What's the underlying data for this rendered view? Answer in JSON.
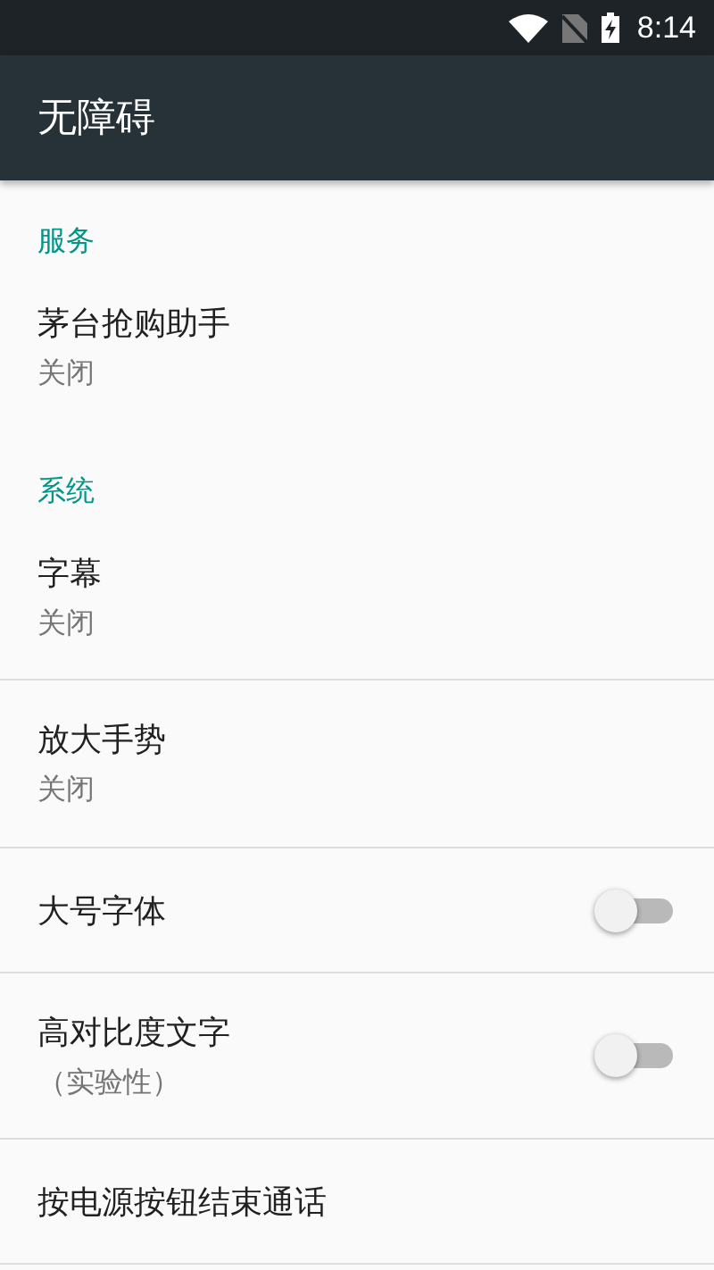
{
  "status_bar": {
    "time": "8:14"
  },
  "toolbar": {
    "title": "无障碍"
  },
  "sections": [
    {
      "header": "服务",
      "items": [
        {
          "kind": "summary",
          "title": "茅台抢购助手",
          "summary": "关闭"
        }
      ]
    },
    {
      "header": "系统",
      "items": [
        {
          "kind": "summary",
          "title": "字幕",
          "summary": "关闭"
        },
        {
          "kind": "summary",
          "title": "放大手势",
          "summary": "关闭"
        },
        {
          "kind": "switch",
          "title": "大号字体",
          "on": false
        },
        {
          "kind": "switch",
          "title": "高对比度文字",
          "summary": "（实验性）",
          "on": false
        },
        {
          "kind": "plain",
          "title": "按电源按钮结束通话"
        }
      ]
    }
  ]
}
